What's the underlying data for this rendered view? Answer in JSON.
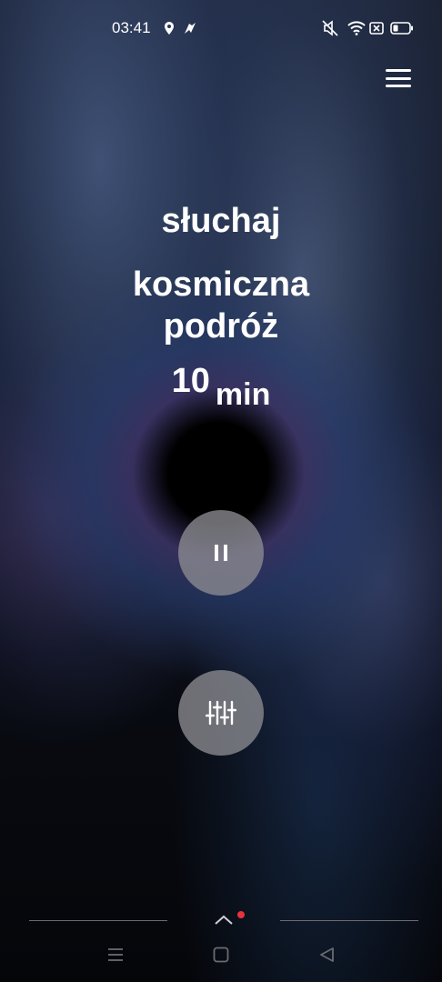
{
  "status_bar": {
    "time": "03:41",
    "icons": [
      "location-icon",
      "app-notification-icon",
      "mute-icon",
      "wifi-icon",
      "sim-off-icon",
      "battery-icon"
    ]
  },
  "header": {
    "menu_icon": "hamburger-menu-icon"
  },
  "session": {
    "mode_label": "słuchaj",
    "title": "kosmiczna podróż",
    "duration_value": "10",
    "duration_unit": "min"
  },
  "controls": {
    "pause_icon": "pause-icon",
    "mixer_icon": "sliders-icon"
  },
  "system_nav": {
    "handle_icon": "chevron-up-icon",
    "handle_dot_color": "#e8323c",
    "buttons": [
      "recent-apps-icon",
      "home-icon",
      "back-icon"
    ]
  }
}
